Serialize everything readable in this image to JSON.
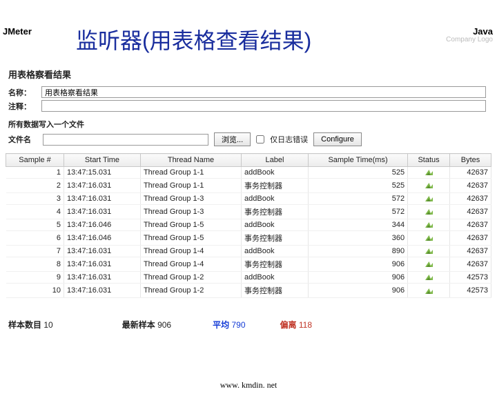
{
  "top": {
    "left": "JMeter",
    "right": "Java",
    "logo": "Company Logo"
  },
  "slide_title": "监听器(用表格查看结果)",
  "panel": {
    "heading": "用表格察看结果",
    "name_label": "名称：",
    "name_value": "用表格察看结果",
    "comment_label": "注释：",
    "write_label": "所有数据写入一个文件",
    "file_label": "文件名",
    "browse_label": "浏览...",
    "log_only_label": "仅日志错误",
    "configure_label": "Configure"
  },
  "cols": [
    "Sample #",
    "Start Time",
    "Thread Name",
    "Label",
    "Sample Time(ms)",
    "Status",
    "Bytes"
  ],
  "rows": [
    {
      "n": 1,
      "t": "13:47:15.031",
      "th": "Thread Group 1-1",
      "lb": "addBook",
      "ms": 525,
      "by": 42637
    },
    {
      "n": 2,
      "t": "13:47:16.031",
      "th": "Thread Group 1-1",
      "lb": "事务控制器",
      "ms": 525,
      "by": 42637
    },
    {
      "n": 3,
      "t": "13:47:16.031",
      "th": "Thread Group 1-3",
      "lb": "addBook",
      "ms": 572,
      "by": 42637
    },
    {
      "n": 4,
      "t": "13:47:16.031",
      "th": "Thread Group 1-3",
      "lb": "事务控制器",
      "ms": 572,
      "by": 42637
    },
    {
      "n": 5,
      "t": "13:47:16.046",
      "th": "Thread Group 1-5",
      "lb": "addBook",
      "ms": 344,
      "by": 42637
    },
    {
      "n": 6,
      "t": "13:47:16.046",
      "th": "Thread Group 1-5",
      "lb": "事务控制器",
      "ms": 360,
      "by": 42637
    },
    {
      "n": 7,
      "t": "13:47:16.031",
      "th": "Thread Group 1-4",
      "lb": "addBook",
      "ms": 890,
      "by": 42637
    },
    {
      "n": 8,
      "t": "13:47:16.031",
      "th": "Thread Group 1-4",
      "lb": "事务控制器",
      "ms": 906,
      "by": 42637
    },
    {
      "n": 9,
      "t": "13:47:16.031",
      "th": "Thread Group 1-2",
      "lb": "addBook",
      "ms": 906,
      "by": 42573
    },
    {
      "n": 10,
      "t": "13:47:16.031",
      "th": "Thread Group 1-2",
      "lb": "事务控制器",
      "ms": 906,
      "by": 42573
    }
  ],
  "summary": {
    "count_k": "样本数目",
    "count_v": "10",
    "latest_k": "最新样本",
    "latest_v": "906",
    "avg_k": "平均",
    "avg_v": "790",
    "dev_k": "偏离",
    "dev_v": "118"
  },
  "footer": "www. kmdin. net",
  "chart_data": {
    "type": "table",
    "title": "用表格察看结果",
    "columns": [
      "Sample #",
      "Start Time",
      "Thread Name",
      "Label",
      "Sample Time(ms)",
      "Status",
      "Bytes"
    ],
    "summary": {
      "samples": 10,
      "latest": 906,
      "average": 790,
      "deviation": 118
    }
  }
}
